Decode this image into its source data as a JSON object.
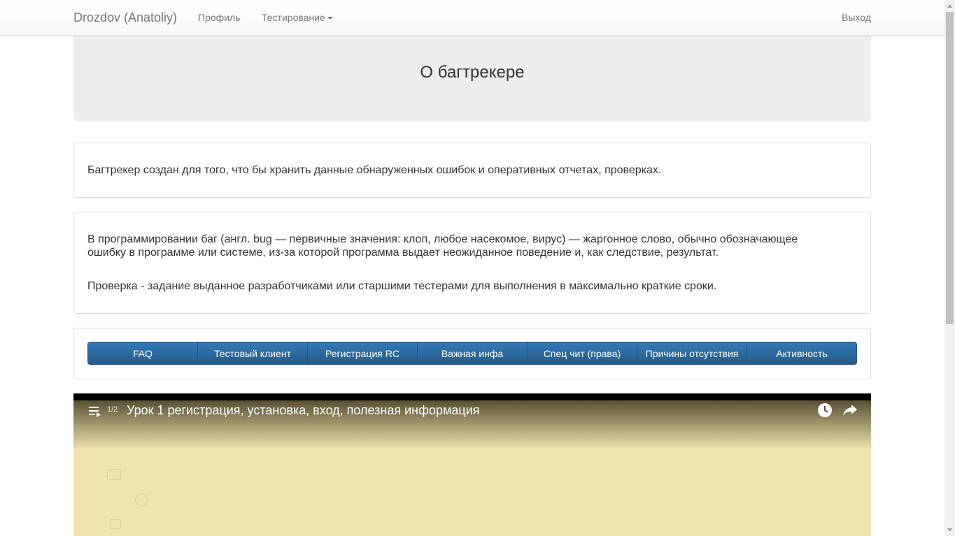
{
  "navbar": {
    "brand": "Drozdov (Anatoliy)",
    "profile": "Профиль",
    "testing": "Тестирование",
    "logout": "Выход"
  },
  "jumbotron": {
    "title": "О багтрекере"
  },
  "intro": {
    "text": "Багтрекер создан для того, что бы хранить данные обнаруженных ошибок и оперативных отчетах, проверках."
  },
  "definitions": {
    "bug": "В программировании баг (англ. bug — первичные значения: клоп, любое насекомое, вирус) — жаргонное слово, обычно обозначающее ошибку в программе или системе, из-за которой программа выдает неожиданное поведение и, как следствие, результат.",
    "check": "Проверка - задание выданное разработчиками или старшими тестерами для выполнения в максимально краткие сроки."
  },
  "buttons": [
    {
      "label": "FAQ"
    },
    {
      "label": "Тестовый клиент"
    },
    {
      "label": "Регистрация RC"
    },
    {
      "label": "Важная инфа"
    },
    {
      "label": "Спец чит (права)"
    },
    {
      "label": "Причины отсутствия"
    },
    {
      "label": "Активность"
    }
  ],
  "video": {
    "counter": "1/2",
    "title": "Урок 1 регистрация, установка, вход, полезная информация"
  },
  "icons": [
    "caret-down-icon",
    "playlist-icon",
    "clock-icon",
    "share-icon"
  ],
  "colors": {
    "primary_button": "#337ab7",
    "jumbotron_bg": "#eeeeee",
    "video_bg": "#ede4ad"
  }
}
